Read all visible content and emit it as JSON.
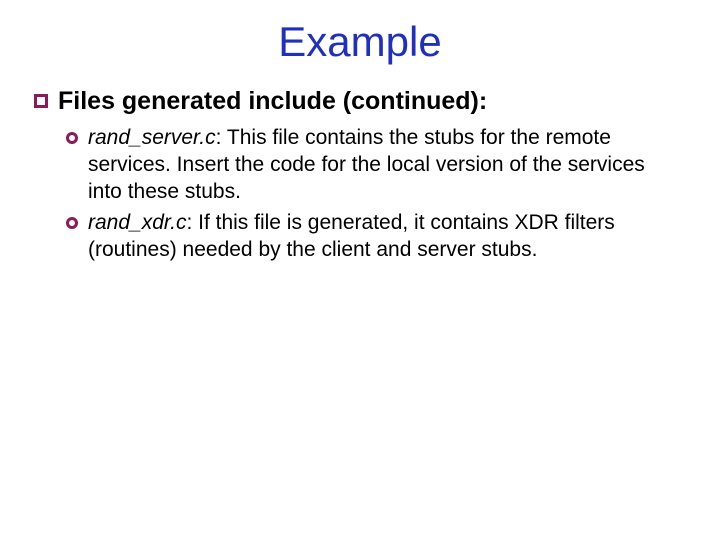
{
  "title": "Example",
  "level1": {
    "heading": "Files generated include (continued):"
  },
  "items": [
    {
      "file": "rand_server.c",
      "sep": ": ",
      "desc": "This file contains the stubs for the remote services. Insert the code for the local version of the services into these stubs."
    },
    {
      "file": "rand_xdr.c",
      "sep": ": ",
      "desc": "If this file is generated, it contains XDR filters (routines) needed by the client and server stubs."
    }
  ]
}
